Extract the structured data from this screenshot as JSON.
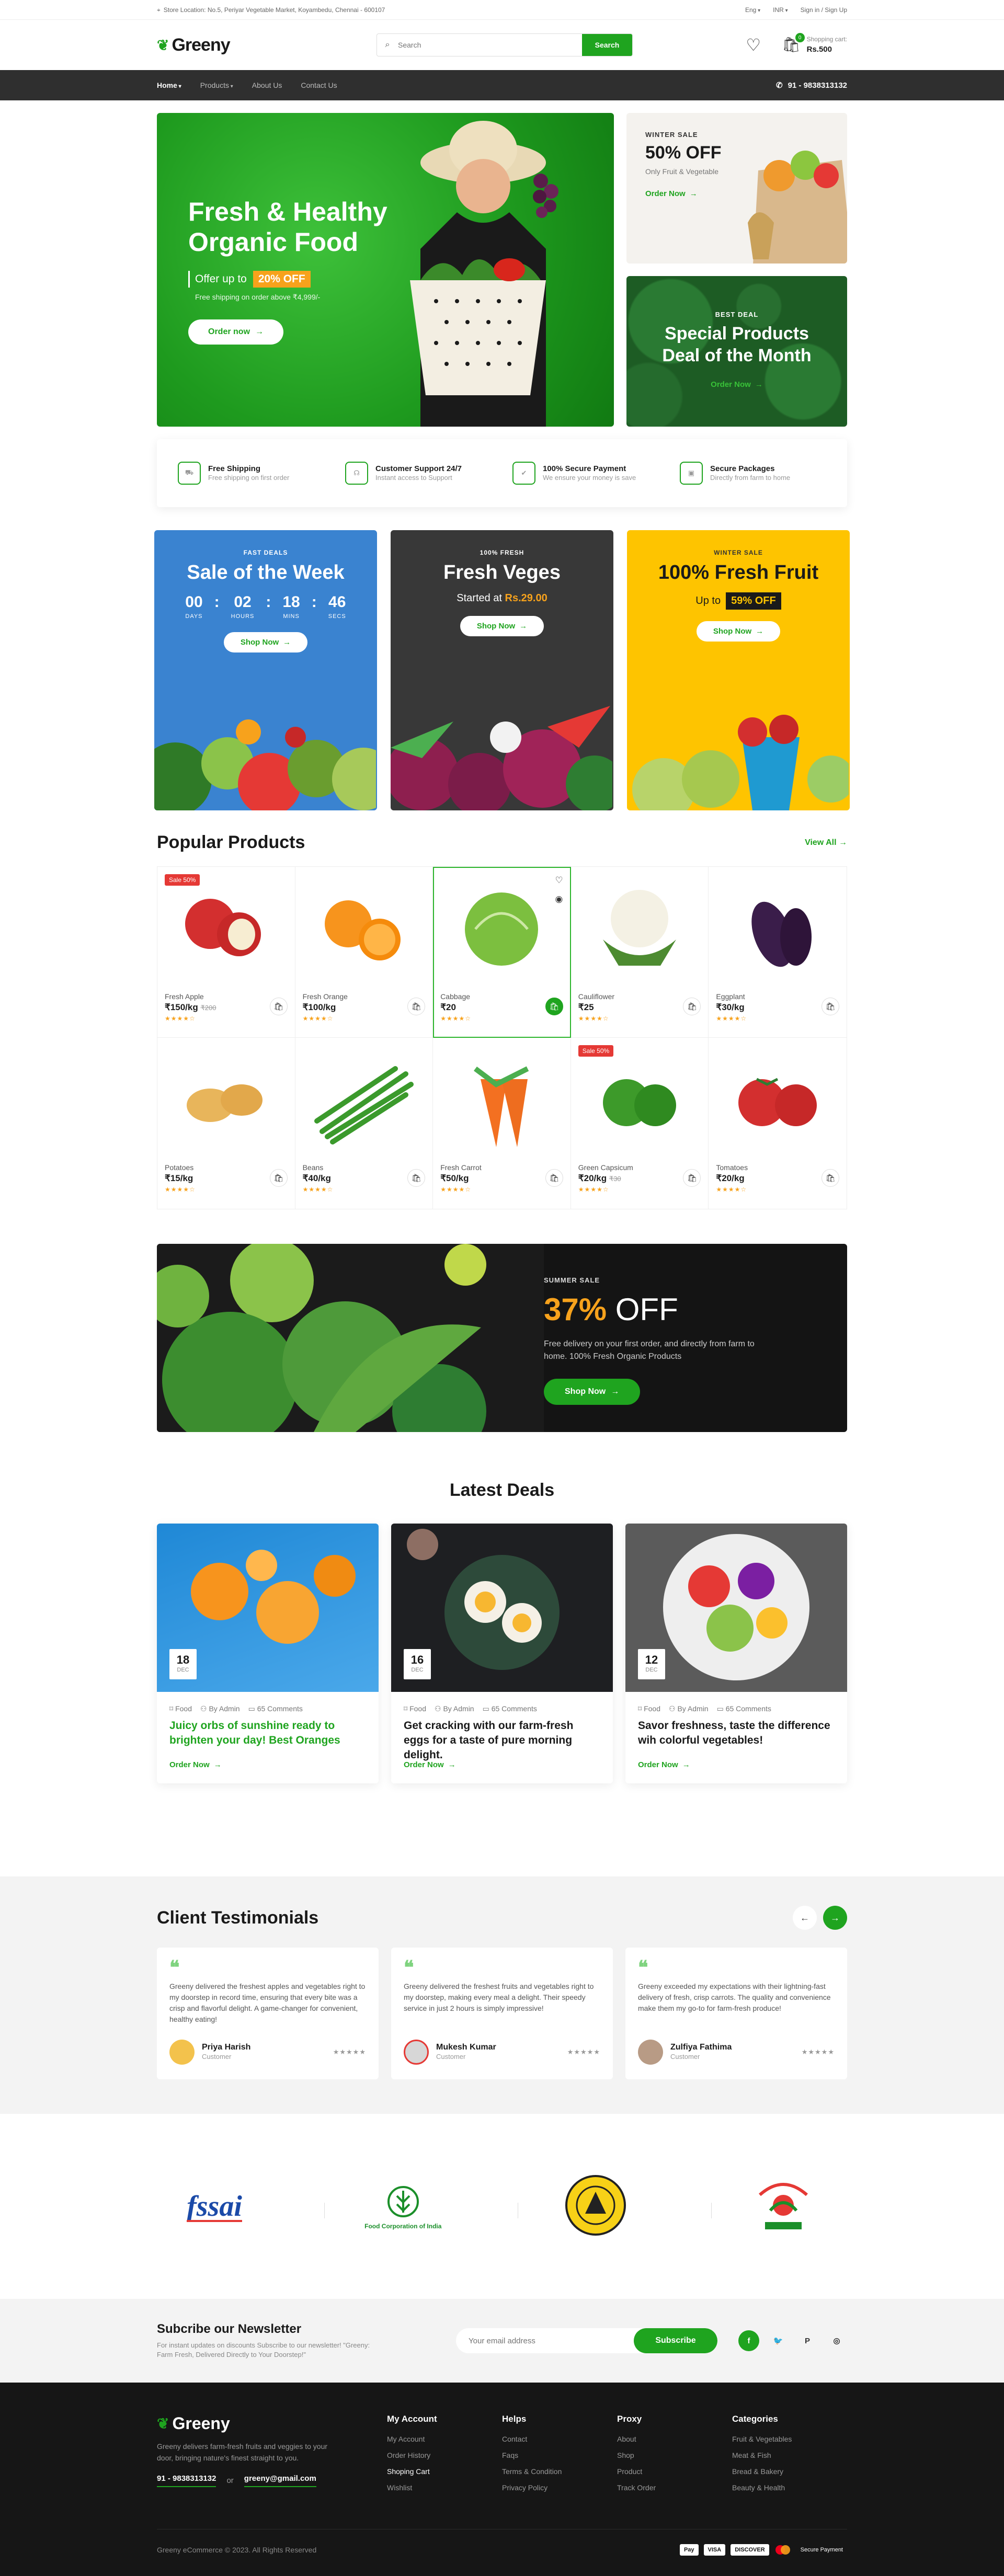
{
  "topbar": {
    "location": "Store Location: No.5, Periyar Vegetable Market, Koyambedu, Chennai - 600107",
    "language": "Eng",
    "currency": "INR",
    "auth": "Sign in / Sign Up"
  },
  "header": {
    "logo": "Greeny",
    "search_placeholder": "Search",
    "search_button": "Search",
    "cart_count": "0",
    "cart_label": "Shopping cart:",
    "cart_total": "Rs.500"
  },
  "nav": {
    "items": [
      "Home",
      "Products",
      "About Us",
      "Contact Us"
    ],
    "phone": "91 - 9838313132"
  },
  "hero": {
    "title_line1": "Fresh & Healthy",
    "title_line2": "Organic Food",
    "offer_text": "Offer up to",
    "offer_tag": "20% OFF",
    "shipping": "Free shipping on order above ₹4,999/-",
    "cta": "Order now",
    "winter": {
      "label": "WINTER SALE",
      "title": "50% OFF",
      "sub": "Only Fruit & Vegetable",
      "cta": "Order Now"
    },
    "deal": {
      "label": "BEST DEAL",
      "title_line1": "Special Products",
      "title_line2": "Deal of the Month",
      "cta": "Order Now"
    }
  },
  "features": [
    {
      "title": "Free Shipping",
      "sub": "Free shipping on first order",
      "icon": "truck-icon"
    },
    {
      "title": "Customer Support 24/7",
      "sub": "Instant access to Support",
      "icon": "headset-icon"
    },
    {
      "title": "100% Secure Payment",
      "sub": "We ensure your money is save",
      "icon": "bag-check-icon"
    },
    {
      "title": "Secure Packages",
      "sub": "Directly from farm to home",
      "icon": "package-icon"
    }
  ],
  "promos": {
    "p1": {
      "label": "FAST DEALS",
      "title": "Sale of the Week",
      "countdown": [
        {
          "v": "00",
          "l": "DAYS"
        },
        {
          "v": "02",
          "l": "HOURS"
        },
        {
          "v": "18",
          "l": "MINS"
        },
        {
          "v": "46",
          "l": "SECS"
        }
      ],
      "cta": "Shop Now"
    },
    "p2": {
      "label": "100% FRESH",
      "title": "Fresh Veges",
      "started": "Started at",
      "price": "Rs.29.00",
      "cta": "Shop Now"
    },
    "p3": {
      "label": "WINTER SALE",
      "title": "100% Fresh Fruit",
      "upto": "Up to",
      "tag": "59% OFF",
      "cta": "Shop Now"
    }
  },
  "popular": {
    "title": "Popular Products",
    "view_all": "View All",
    "products": [
      {
        "name": "Fresh Apple",
        "price": "₹150/kg",
        "old": "₹200",
        "sale": "Sale 50%"
      },
      {
        "name": "Fresh Orange",
        "price": "₹100/kg",
        "old": "",
        "sale": ""
      },
      {
        "name": "Cabbage",
        "price": "₹20",
        "old": "",
        "sale": ""
      },
      {
        "name": "Cauliflower",
        "price": "₹25",
        "old": "",
        "sale": ""
      },
      {
        "name": "Eggplant",
        "price": "₹30/kg",
        "old": "",
        "sale": ""
      },
      {
        "name": "Potatoes",
        "price": "₹15/kg",
        "old": "",
        "sale": ""
      },
      {
        "name": "Beans",
        "price": "₹40/kg",
        "old": "",
        "sale": ""
      },
      {
        "name": "Fresh Carrot",
        "price": "₹50/kg",
        "old": "",
        "sale": ""
      },
      {
        "name": "Green Capsicum",
        "price": "₹20/kg",
        "old": "₹30",
        "sale": "Sale 50%"
      },
      {
        "name": "Tomatoes",
        "price": "₹20/kg",
        "old": "",
        "sale": ""
      }
    ]
  },
  "banner": {
    "label": "SUMMER SALE",
    "pct": "37%",
    "off": "OFF",
    "text": "Free delivery on your first order, and directly from farm to home. 100% Fresh Organic Products",
    "cta": "Shop Now"
  },
  "deals": {
    "title": "Latest Deals",
    "items": [
      {
        "day": "18",
        "month": "DEC",
        "cat": "Food",
        "author": "By Admin",
        "comments": "65 Comments",
        "title": "Juicy orbs of sunshine ready to brighten your day! Best Oranges",
        "cta": "Order Now"
      },
      {
        "day": "16",
        "month": "DEC",
        "cat": "Food",
        "author": "By Admin",
        "comments": "65 Comments",
        "title": "Get cracking with our farm-fresh eggs for a taste of pure morning delight.",
        "cta": "Order Now"
      },
      {
        "day": "12",
        "month": "DEC",
        "cat": "Food",
        "author": "By Admin",
        "comments": "65 Comments",
        "title": "Savor freshness, taste the difference wih colorful vegetables!",
        "cta": "Order Now"
      }
    ]
  },
  "testimonials": {
    "title": "Client Testimonials",
    "items": [
      {
        "text": "Greeny delivered the freshest apples and vegetables right to my doorstep in record time, ensuring that every bite was a crisp and flavorful delight. A game-changer for convenient, healthy eating!",
        "name": "Priya Harish",
        "role": "Customer"
      },
      {
        "text": "Greeny delivered the freshest fruits and vegetables right to my doorstep, making every meal a delight. Their speedy service in just 2 hours is simply impressive!",
        "name": "Mukesh Kumar",
        "role": "Customer"
      },
      {
        "text": "Greeny exceeded my expectations with their lightning-fast delivery of fresh, crisp carrots. The quality and convenience make them my go-to for farm-fresh produce!",
        "name": "Zulfiya Fathima",
        "role": "Customer"
      }
    ]
  },
  "partners": {
    "fssai": "fssai",
    "fci": "Food Corporation of India"
  },
  "newsletter": {
    "title": "Subcribe our Newsletter",
    "text": "For instant updates on discounts Subscribe to our newsletter! \"Greeny: Farm Fresh, Delivered Directly to Your Doorstep!\"",
    "placeholder": "Your email address",
    "button": "Subscribe"
  },
  "footer": {
    "logo": "Greeny",
    "about": "Greeny delivers farm-fresh fruits and veggies to your door, bringing nature's finest straight to you.",
    "phone": "91 - 9838313132",
    "or": "or",
    "email": "greeny@gmail.com",
    "cols": [
      {
        "title": "My Account",
        "items": [
          "My Account",
          "Order History",
          "Shoping Cart",
          "Wishlist"
        ]
      },
      {
        "title": "Helps",
        "items": [
          "Contact",
          "Faqs",
          "Terms & Condition",
          "Privacy Policy"
        ]
      },
      {
        "title": "Proxy",
        "items": [
          "About",
          "Shop",
          "Product",
          "Track Order"
        ]
      },
      {
        "title": "Categories",
        "items": [
          "Fruit & Vegetables",
          "Meat & Fish",
          "Bread & Bakery",
          "Beauty & Health"
        ]
      }
    ],
    "copyright": "Greeny eCommerce © 2023. All Rights Reserved",
    "payments": [
      "Pay",
      "VISA",
      "DISCOVER"
    ],
    "secure": "Secure Payment"
  },
  "colors": {
    "brand": "#1fa41f",
    "accent": "#f7a21c",
    "dark": "#161616"
  }
}
